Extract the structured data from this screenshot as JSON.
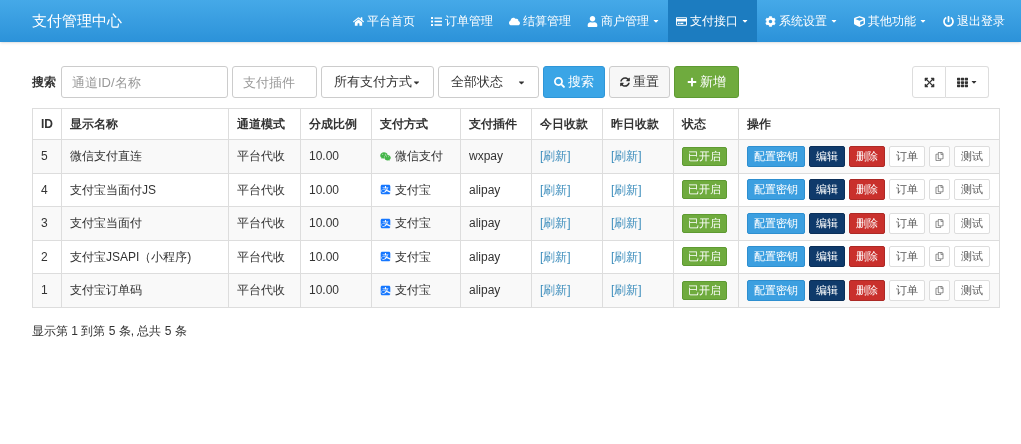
{
  "navbar": {
    "brand": "支付管理中心",
    "items": [
      {
        "label": "平台首页",
        "kind": "home",
        "dropdown": false,
        "selected": false
      },
      {
        "label": "订单管理",
        "kind": "list",
        "dropdown": false,
        "selected": false
      },
      {
        "label": "结算管理",
        "kind": "cloud",
        "dropdown": false,
        "selected": false
      },
      {
        "label": "商户管理",
        "kind": "user",
        "dropdown": true,
        "selected": false
      },
      {
        "label": "支付接口",
        "kind": "card",
        "dropdown": true,
        "selected": true
      },
      {
        "label": "系统设置",
        "kind": "gear",
        "dropdown": true,
        "selected": false
      },
      {
        "label": "其他功能",
        "kind": "cube",
        "dropdown": true,
        "selected": false
      },
      {
        "label": "退出登录",
        "kind": "power",
        "dropdown": false,
        "selected": false
      }
    ]
  },
  "toolbar": {
    "search_label": "搜索",
    "id_field": {
      "placeholder": "通道ID/名称"
    },
    "plugin_field": {
      "placeholder": "支付插件"
    },
    "method_select": {
      "value": "所有支付方式"
    },
    "status_select": {
      "value": "全部状态"
    },
    "search_button": "搜索",
    "reset_button": "重置",
    "add_button": "新增"
  },
  "table": {
    "columns": [
      "ID",
      "显示名称",
      "通道模式",
      "分成比例",
      "支付方式",
      "支付插件",
      "今日收款",
      "昨日收款",
      "状态",
      "操作"
    ],
    "rows": [
      {
        "id": "5",
        "name": "微信支付直连",
        "mode": "平台代收",
        "ratio": "10.00",
        "method": {
          "kind": "wechat",
          "label": "微信支付"
        },
        "plugin": "wxpay",
        "today": "[刷新]",
        "yesterday": "[刷新]",
        "status": {
          "label": "已开启",
          "on": true
        },
        "actions": [
          {
            "kind": "primary",
            "label": "配置密钥"
          },
          {
            "kind": "navy",
            "label": "编辑"
          },
          {
            "kind": "danger",
            "label": "删除"
          },
          {
            "kind": "default",
            "label": "订单"
          },
          {
            "kind": "copy"
          },
          {
            "kind": "default",
            "label": "测试"
          }
        ]
      },
      {
        "id": "4",
        "name": "支付宝当面付JS",
        "mode": "平台代收",
        "ratio": "10.00",
        "method": {
          "kind": "alipay",
          "label": "支付宝"
        },
        "plugin": "alipay",
        "today": "[刷新]",
        "yesterday": "[刷新]",
        "status": {
          "label": "已开启",
          "on": true
        },
        "actions": [
          {
            "kind": "primary",
            "label": "配置密钥"
          },
          {
            "kind": "navy",
            "label": "编辑"
          },
          {
            "kind": "danger",
            "label": "删除"
          },
          {
            "kind": "default",
            "label": "订单"
          },
          {
            "kind": "copy"
          },
          {
            "kind": "default",
            "label": "测试"
          }
        ]
      },
      {
        "id": "3",
        "name": "支付宝当面付",
        "mode": "平台代收",
        "ratio": "10.00",
        "method": {
          "kind": "alipay",
          "label": "支付宝"
        },
        "plugin": "alipay",
        "today": "[刷新]",
        "yesterday": "[刷新]",
        "status": {
          "label": "已开启",
          "on": true
        },
        "actions": [
          {
            "kind": "primary",
            "label": "配置密钥"
          },
          {
            "kind": "navy",
            "label": "编辑"
          },
          {
            "kind": "danger",
            "label": "删除"
          },
          {
            "kind": "default",
            "label": "订单"
          },
          {
            "kind": "copy"
          },
          {
            "kind": "default",
            "label": "测试"
          }
        ]
      },
      {
        "id": "2",
        "name": "支付宝JSAPI（小程序)",
        "mode": "平台代收",
        "ratio": "10.00",
        "method": {
          "kind": "alipay",
          "label": "支付宝"
        },
        "plugin": "alipay",
        "today": "[刷新]",
        "yesterday": "[刷新]",
        "status": {
          "label": "已开启",
          "on": true
        },
        "actions": [
          {
            "kind": "primary",
            "label": "配置密钥"
          },
          {
            "kind": "navy",
            "label": "编辑"
          },
          {
            "kind": "danger",
            "label": "删除"
          },
          {
            "kind": "default",
            "label": "订单"
          },
          {
            "kind": "copy"
          },
          {
            "kind": "default",
            "label": "测试"
          }
        ]
      },
      {
        "id": "1",
        "name": "支付宝订单码",
        "mode": "平台代收",
        "ratio": "10.00",
        "method": {
          "kind": "alipay",
          "label": "支付宝"
        },
        "plugin": "alipay",
        "today": "[刷新]",
        "yesterday": "[刷新]",
        "status": {
          "label": "已开启",
          "on": true
        },
        "actions": [
          {
            "kind": "primary",
            "label": "配置密钥"
          },
          {
            "kind": "navy",
            "label": "编辑"
          },
          {
            "kind": "danger",
            "label": "删除"
          },
          {
            "kind": "default",
            "label": "订单"
          },
          {
            "kind": "copy"
          },
          {
            "kind": "default",
            "label": "测试"
          }
        ]
      }
    ]
  },
  "pagination_info": "显示第 1 到第 5 条, 总共 5 条"
}
